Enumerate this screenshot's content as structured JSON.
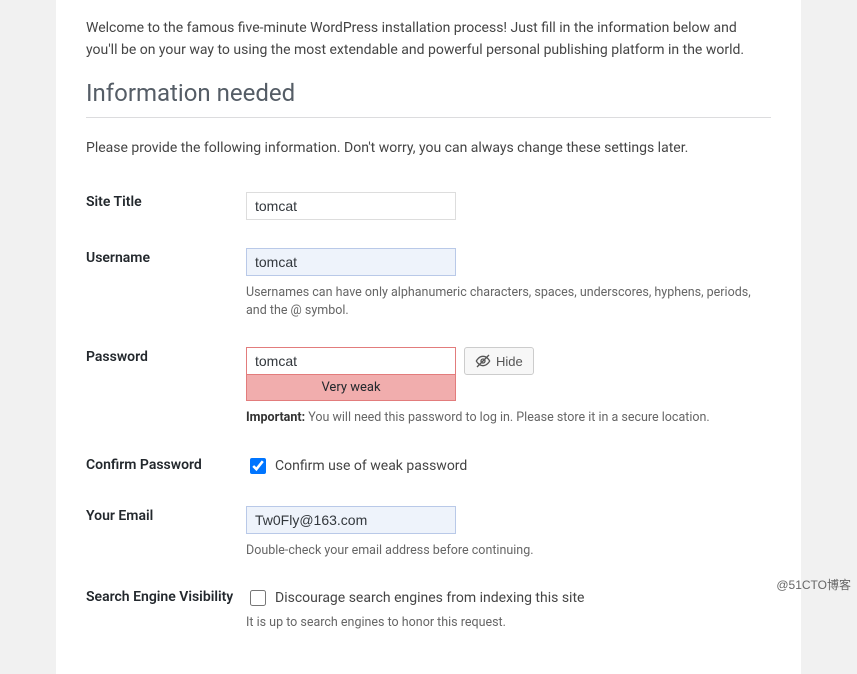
{
  "intro": "Welcome to the famous five-minute WordPress installation process! Just fill in the information below and you'll be on your way to using the most extendable and powerful personal publishing platform in the world.",
  "section_heading": "Information needed",
  "subintro": "Please provide the following information. Don't worry, you can always change these settings later.",
  "fields": {
    "site_title": {
      "label": "Site Title",
      "value": "tomcat"
    },
    "username": {
      "label": "Username",
      "value": "tomcat",
      "hint": "Usernames can have only alphanumeric characters, spaces, underscores, hyphens, periods, and the @ symbol."
    },
    "password": {
      "label": "Password",
      "value": "tomcat",
      "hide_label": "Hide",
      "strength": "Very weak",
      "important_label": "Important:",
      "important_text": " You will need this password to log in. Please store it in a secure location."
    },
    "confirm_password": {
      "label": "Confirm Password",
      "checkbox_label": "Confirm use of weak password",
      "checked": true
    },
    "email": {
      "label": "Your Email",
      "value": "Tw0Fly@163.com",
      "hint": "Double-check your email address before continuing."
    },
    "search_visibility": {
      "label": "Search Engine Visibility",
      "checkbox_label": "Discourage search engines from indexing this site",
      "checked": false,
      "hint": "It is up to search engines to honor this request."
    }
  },
  "watermark": "@51CTO博客"
}
